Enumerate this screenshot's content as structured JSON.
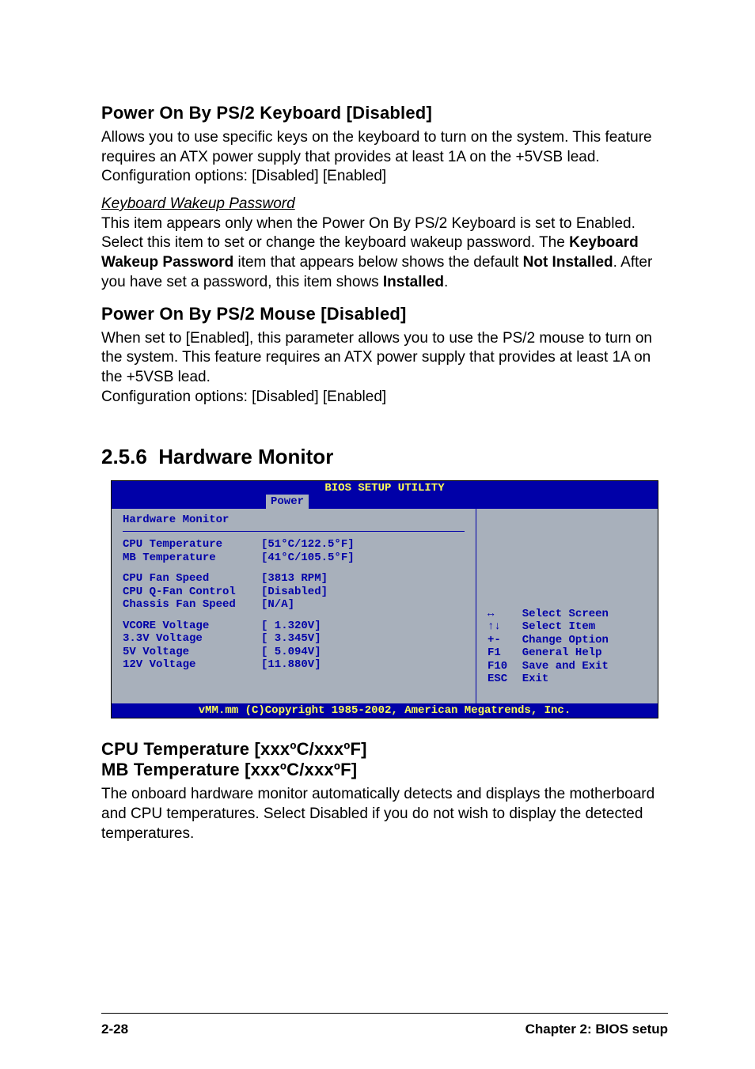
{
  "sections": {
    "s1": {
      "heading": "Power On By PS/2 Keyboard [Disabled]",
      "body": "Allows you to use specific keys on the keyboard to turn on the system. This feature requires an ATX power supply that provides at least 1A on the +5VSB lead. Configuration options: [Disabled] [Enabled]",
      "sub_heading": "Keyboard Wakeup Password",
      "sub_body_1": "This item appears only when the Power On By PS/2 Keyboard is set to Enabled.  Select this item to set or change the keyboard wakeup password.  The ",
      "sub_bold_1": "Keyboard Wakeup Password",
      "sub_body_2": " item that appears below shows the default ",
      "sub_bold_2": "Not Installed",
      "sub_body_3": ". After you have set a password, this item shows ",
      "sub_bold_3": "Installed",
      "sub_body_4": "."
    },
    "s2": {
      "heading": "Power On By PS/2 Mouse [Disabled]",
      "body1": "When set to [Enabled], this parameter allows you to use the PS/2 mouse to turn on the system. This feature requires an ATX power supply that provides at least 1A on the +5VSB lead.",
      "body2": "Configuration options: [Disabled] [Enabled]"
    },
    "major": {
      "num": "2.5.6",
      "title": "Hardware Monitor"
    },
    "s3": {
      "heading1": "CPU Temperature [xxxºC/xxxºF]",
      "heading2": "MB Temperature [xxxºC/xxxºF]",
      "body": "The onboard hardware monitor automatically detects and displays the motherboard and CPU temperatures. Select Disabled if you do not wish to display the detected temperatures."
    }
  },
  "bios": {
    "title": "BIOS SETUP UTILITY",
    "tab": "Power",
    "panel_title": "Hardware Monitor",
    "rows": [
      {
        "label": "CPU Temperature",
        "value": "[51°C/122.5°F]"
      },
      {
        "label": "MB Temperature",
        "value": "[41°C/105.5°F]"
      }
    ],
    "rows2": [
      {
        "label": "CPU Fan Speed",
        "value": "[3813 RPM]"
      },
      {
        "label": "CPU Q-Fan Control",
        "value": "[Disabled]"
      },
      {
        "label": "Chassis Fan Speed",
        "value": "[N/A]"
      }
    ],
    "rows3": [
      {
        "label": "VCORE Voltage",
        "value": "[ 1.320V]"
      },
      {
        "label": "3.3V Voltage",
        "value": "[ 3.345V]"
      },
      {
        "label": "5V Voltage",
        "value": "[ 5.094V]"
      },
      {
        "label": "12V Voltage",
        "value": "[11.880V]"
      }
    ],
    "help": [
      {
        "key": "↔",
        "action": "Select Screen"
      },
      {
        "key": "↑↓",
        "action": "Select Item"
      },
      {
        "key": "+-",
        "action": "Change Option"
      },
      {
        "key": "F1",
        "action": "General Help"
      },
      {
        "key": "F10",
        "action": "Save and Exit"
      },
      {
        "key": "ESC",
        "action": "Exit"
      }
    ],
    "footer": "vMM.mm (C)Copyright 1985-2002, American Megatrends, Inc."
  },
  "footer": {
    "left": "2-28",
    "right": "Chapter 2: BIOS setup"
  }
}
